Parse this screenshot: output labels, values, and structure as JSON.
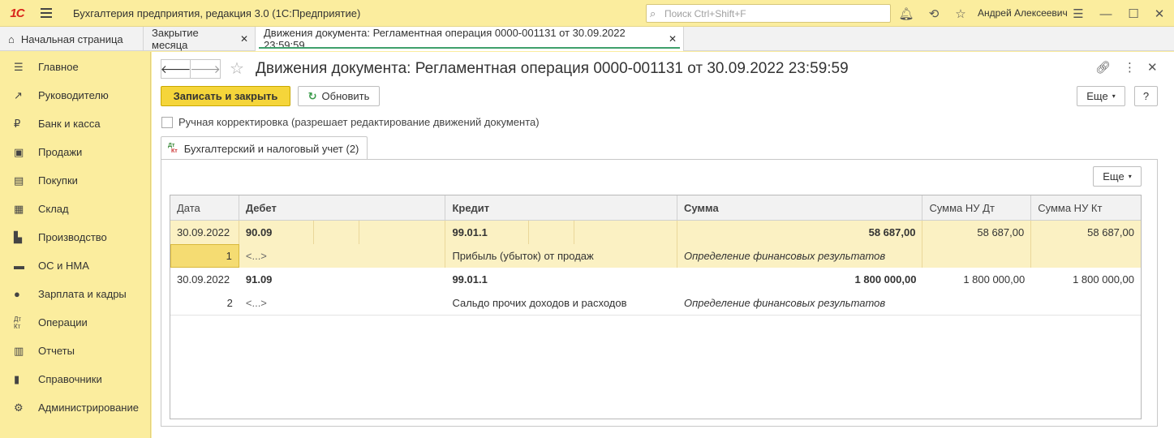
{
  "app": {
    "logo": "1С",
    "title": "Бухгалтерия предприятия, редакция 3.0  (1С:Предприятие)",
    "search_placeholder": "Поиск Ctrl+Shift+F",
    "user": "Андрей Алексеевич"
  },
  "tabs": [
    {
      "label": "Начальная страница"
    },
    {
      "label": "Закрытие месяца"
    },
    {
      "label": "Движения документа: Регламентная операция 0000-001131 от 30.09.2022 23:59:59"
    }
  ],
  "sidebar": {
    "items": [
      {
        "label": "Главное",
        "icon": "menu-lines-icon"
      },
      {
        "label": "Руководителю",
        "icon": "trend-icon"
      },
      {
        "label": "Банк и касса",
        "icon": "ruble-coin-icon"
      },
      {
        "label": "Продажи",
        "icon": "bag-icon"
      },
      {
        "label": "Покупки",
        "icon": "cart-icon"
      },
      {
        "label": "Склад",
        "icon": "warehouse-icon"
      },
      {
        "label": "Производство",
        "icon": "factory-icon"
      },
      {
        "label": "ОС и НМА",
        "icon": "truck-icon"
      },
      {
        "label": "Зарплата и кадры",
        "icon": "person-icon"
      },
      {
        "label": "Операции",
        "icon": "dt-kt-icon"
      },
      {
        "label": "Отчеты",
        "icon": "bar-chart-icon"
      },
      {
        "label": "Справочники",
        "icon": "book-icon"
      },
      {
        "label": "Администрирование",
        "icon": "gear-icon"
      }
    ]
  },
  "document": {
    "title": "Движения документа: Регламентная операция 0000-001131 от 30.09.2022 23:59:59",
    "save_close": "Записать и закрыть",
    "refresh": "Обновить",
    "more": "Еще",
    "help": "?",
    "manual_correction": "Ручная корректировка (разрешает редактирование движений документа)",
    "tab_label": "Бухгалтерский и налоговый учет (2)",
    "table_more": "Еще"
  },
  "table": {
    "headers": [
      "Дата",
      "Дебет",
      "Кредит",
      "Сумма",
      "Сумма НУ Дт",
      "Сумма НУ Кт"
    ],
    "rows": [
      {
        "date": "30.09.2022",
        "debit": "90.09",
        "credit": "99.01.1",
        "sum": "58 687,00",
        "nu_dt": "58 687,00",
        "nu_kt": "58 687,00",
        "num": "1",
        "debit_sub": "<...>",
        "credit_sub": "Прибыль (убыток) от продаж",
        "content": "Определение финансовых результатов"
      },
      {
        "date": "30.09.2022",
        "debit": "91.09",
        "credit": "99.01.1",
        "sum": "1 800 000,00",
        "nu_dt": "1 800 000,00",
        "nu_kt": "1 800 000,00",
        "num": "2",
        "debit_sub": "<...>",
        "credit_sub": "Сальдо прочих доходов и расходов",
        "content": "Определение финансовых результатов"
      }
    ]
  }
}
